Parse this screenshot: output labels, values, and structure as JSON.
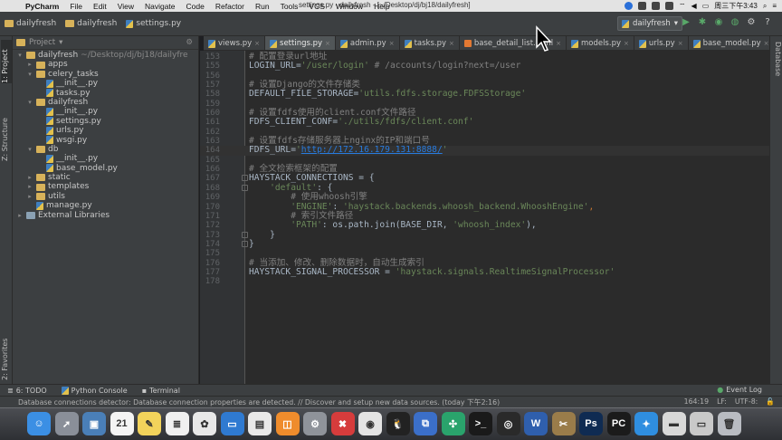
{
  "menubar": {
    "app_name": "PyCharm",
    "menus": [
      "File",
      "Edit",
      "View",
      "Navigate",
      "Code",
      "Refactor",
      "Run",
      "Tools",
      "VCS",
      "Window",
      "Help"
    ],
    "window_title": "settings.py - dailyfresh - [~/Desktop/dj/bj18/dailyfresh]",
    "clock": "周三下午3:43"
  },
  "navbar": {
    "crumbs": [
      "dailyfresh",
      "dailyfresh",
      "settings.py"
    ],
    "run_config": "dailyfresh"
  },
  "sidebar": {
    "project_tab": "1: Project",
    "structure_tab": "Z: Structure",
    "favorites_tab": "2: Favorites",
    "header_label": "Project"
  },
  "tree": [
    {
      "label": "dailyfresh",
      "path": "~/Desktop/dj/bj18/dailyfre",
      "kind": "folder",
      "depth": 0,
      "arrow": "▾"
    },
    {
      "label": "apps",
      "kind": "folder",
      "depth": 1,
      "arrow": "▸"
    },
    {
      "label": "celery_tasks",
      "kind": "folder",
      "depth": 1,
      "arrow": "▾"
    },
    {
      "label": "__init__.py",
      "kind": "py",
      "depth": 2,
      "arrow": ""
    },
    {
      "label": "tasks.py",
      "kind": "py",
      "depth": 2,
      "arrow": ""
    },
    {
      "label": "dailyfresh",
      "kind": "folder",
      "depth": 1,
      "arrow": "▾"
    },
    {
      "label": "__init__.py",
      "kind": "py",
      "depth": 2,
      "arrow": ""
    },
    {
      "label": "settings.py",
      "kind": "py",
      "depth": 2,
      "arrow": ""
    },
    {
      "label": "urls.py",
      "kind": "py",
      "depth": 2,
      "arrow": ""
    },
    {
      "label": "wsgi.py",
      "kind": "py",
      "depth": 2,
      "arrow": ""
    },
    {
      "label": "db",
      "kind": "folder",
      "depth": 1,
      "arrow": "▾"
    },
    {
      "label": "__init__.py",
      "kind": "py",
      "depth": 2,
      "arrow": ""
    },
    {
      "label": "base_model.py",
      "kind": "py",
      "depth": 2,
      "arrow": ""
    },
    {
      "label": "static",
      "kind": "folder",
      "depth": 1,
      "arrow": "▸"
    },
    {
      "label": "templates",
      "kind": "folder",
      "depth": 1,
      "arrow": "▸"
    },
    {
      "label": "utils",
      "kind": "folder",
      "depth": 1,
      "arrow": "▸"
    },
    {
      "label": "manage.py",
      "kind": "py",
      "depth": 1,
      "arrow": ""
    },
    {
      "label": "External Libraries",
      "kind": "lib",
      "depth": 0,
      "arrow": "▸"
    }
  ],
  "tabs": [
    {
      "label": "views.py",
      "active": false
    },
    {
      "label": "settings.py",
      "active": true
    },
    {
      "label": "admin.py",
      "active": false
    },
    {
      "label": "tasks.py",
      "active": false
    },
    {
      "label": "base_detail_list.html",
      "active": false
    },
    {
      "label": "models.py",
      "active": false
    },
    {
      "label": "urls.py",
      "active": false
    },
    {
      "label": "base_model.py",
      "active": false
    }
  ],
  "code_lines": [
    {
      "n": "153",
      "t": [
        [
          "cm",
          "# 配置登录url地址"
        ]
      ]
    },
    {
      "n": "155",
      "t": [
        [
          "id",
          "LOGIN_URL="
        ],
        [
          "str",
          "'/user/login'"
        ],
        [
          "cm",
          " # /accounts/login?next=/user"
        ]
      ]
    },
    {
      "n": "156",
      "t": []
    },
    {
      "n": "157",
      "t": [
        [
          "cm",
          "# 设置Django的文件存储类"
        ]
      ]
    },
    {
      "n": "158",
      "t": [
        [
          "id",
          "DEFAULT_FILE_STORAGE="
        ],
        [
          "str",
          "'utils.fdfs.storage.FDFSStorage'"
        ]
      ]
    },
    {
      "n": "159",
      "t": []
    },
    {
      "n": "160",
      "t": [
        [
          "cm",
          "# 设置fdfs使用的client.conf文件路径"
        ]
      ]
    },
    {
      "n": "161",
      "t": [
        [
          "id",
          "FDFS_CLIENT_CONF="
        ],
        [
          "str",
          "'./utils/fdfs/client.conf'"
        ]
      ]
    },
    {
      "n": "162",
      "t": []
    },
    {
      "n": "163",
      "t": [
        [
          "cm",
          "# 设置fdfs存储服务器上nginx的IP和端口号"
        ]
      ]
    },
    {
      "n": "164",
      "t": [
        [
          "id",
          "FDFS_URL="
        ],
        [
          "str",
          "'"
        ],
        [
          "url",
          "http://172.16.179.131:8888/"
        ],
        [
          "str",
          "'"
        ]
      ]
    },
    {
      "n": "165",
      "t": []
    },
    {
      "n": "166",
      "t": [
        [
          "cm",
          "# 全文检索框架的配置"
        ]
      ]
    },
    {
      "n": "167",
      "t": [
        [
          "id",
          "HAYSTACK_CONNECTIONS = {"
        ]
      ]
    },
    {
      "n": "168",
      "t": [
        [
          "id",
          "    "
        ],
        [
          "str",
          "'default'"
        ],
        [
          "id",
          ": {"
        ]
      ]
    },
    {
      "n": "169",
      "t": [
        [
          "cm",
          "        # 使用whoosh引擎"
        ]
      ]
    },
    {
      "n": "170",
      "t": [
        [
          "id",
          "        "
        ],
        [
          "str",
          "'ENGINE'"
        ],
        [
          "id",
          ": "
        ],
        [
          "str",
          "'haystack.backends.whoosh_backend.WhooshEngine'"
        ],
        [
          "kw",
          ","
        ]
      ]
    },
    {
      "n": "171",
      "t": [
        [
          "cm",
          "        # 索引文件路径"
        ]
      ]
    },
    {
      "n": "172",
      "t": [
        [
          "id",
          "        "
        ],
        [
          "str",
          "'PATH'"
        ],
        [
          "id",
          ": os.path.join(BASE_DIR, "
        ],
        [
          "str",
          "'whoosh_index'"
        ],
        [
          "id",
          "),"
        ]
      ]
    },
    {
      "n": "173",
      "t": [
        [
          "id",
          "    }"
        ]
      ]
    },
    {
      "n": "174",
      "t": [
        [
          "id",
          "}"
        ]
      ]
    },
    {
      "n": "175",
      "t": []
    },
    {
      "n": "176",
      "t": [
        [
          "cm",
          "# 当添加、修改、删除数据时，自动生成索引"
        ]
      ]
    },
    {
      "n": "177",
      "t": [
        [
          "id",
          "HAYSTACK_SIGNAL_PROCESSOR = "
        ],
        [
          "str",
          "'haystack.signals.RealtimeSignalProcessor'"
        ]
      ]
    },
    {
      "n": "178",
      "t": []
    }
  ],
  "right_tab": "Database",
  "bottom_tools": [
    "6: TODO",
    "Python Console",
    "Terminal"
  ],
  "event_log": "Event Log",
  "status": {
    "message": "Database connections detector: Database connection properties are detected. // Discover and setup new data sources. (today 下午2:16)",
    "position": "164:19",
    "line_sep": "LF:",
    "encoding": "UTF-8:"
  },
  "dock": [
    {
      "name": "Finder",
      "color": "#3b8fe4",
      "glyph": "☺"
    },
    {
      "name": "Launchpad",
      "color": "#8a8f99",
      "glyph": "➚"
    },
    {
      "name": "Preview",
      "color": "#4a7fb8",
      "glyph": "▣"
    },
    {
      "name": "Calendar",
      "color": "#f4f4f4",
      "glyph": "21"
    },
    {
      "name": "Notes",
      "color": "#f2d35b",
      "glyph": "✎"
    },
    {
      "name": "Reminders",
      "color": "#f0f0f0",
      "glyph": "≣"
    },
    {
      "name": "Photos",
      "color": "#e8e8e8",
      "glyph": "✿"
    },
    {
      "name": "Keynote",
      "color": "#2f7ad1",
      "glyph": "▭"
    },
    {
      "name": "Sublime",
      "color": "#e9e9e9",
      "glyph": "▤"
    },
    {
      "name": "iBooks",
      "color": "#ef8c2c",
      "glyph": "◫"
    },
    {
      "name": "System Preferences",
      "color": "#8f939a",
      "glyph": "⚙"
    },
    {
      "name": "XMind",
      "color": "#d63c3c",
      "glyph": "✖"
    },
    {
      "name": "Chrome",
      "color": "#e4e4e4",
      "glyph": "◉"
    },
    {
      "name": "QQ",
      "color": "#222222",
      "glyph": "🐧"
    },
    {
      "name": "Screen Sharing",
      "color": "#3b6fc9",
      "glyph": "⧉"
    },
    {
      "name": "PyCharm Help",
      "color": "#2aa36c",
      "glyph": "✣"
    },
    {
      "name": "Terminal",
      "color": "#1a1a1a",
      "glyph": ">_"
    },
    {
      "name": "OBS",
      "color": "#2a2a2a",
      "glyph": "◎"
    },
    {
      "name": "Word",
      "color": "#2f5fad",
      "glyph": "W"
    },
    {
      "name": "Archive",
      "color": "#9a7c4a",
      "glyph": "✂"
    },
    {
      "name": "Photoshop",
      "color": "#0f2b52",
      "glyph": "Ps"
    },
    {
      "name": "PyCharm",
      "color": "#1b1b1b",
      "glyph": "PC"
    },
    {
      "name": "Safari",
      "color": "#2f8ee0",
      "glyph": "✦"
    },
    {
      "name": "Drive",
      "color": "#d8d8d8",
      "glyph": "▬"
    },
    {
      "name": "Disk",
      "color": "#c9c9c9",
      "glyph": "▭"
    },
    {
      "name": "Trash",
      "color": "#b9bcc2",
      "glyph": "🗑"
    }
  ]
}
